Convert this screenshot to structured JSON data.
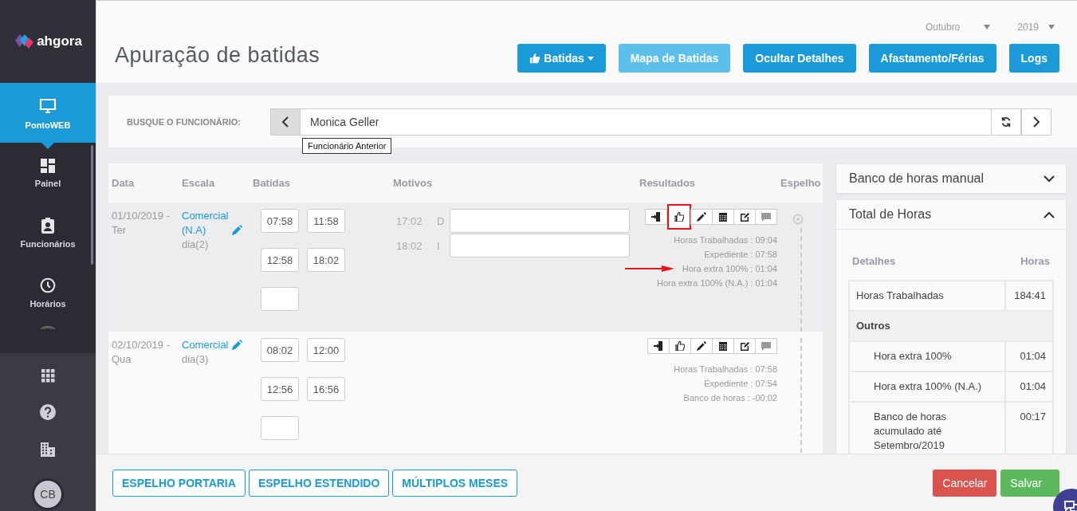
{
  "brand": {
    "name": "ahgora"
  },
  "nav": [
    {
      "label": "PontoWEB",
      "selected": true
    },
    {
      "label": "Painel",
      "selected": false
    },
    {
      "label": "Funcionários",
      "selected": false
    },
    {
      "label": "Horários",
      "selected": false
    }
  ],
  "tools": [
    {
      "kind": "apps"
    },
    {
      "kind": "help"
    },
    {
      "kind": "building"
    },
    {
      "kind": "avatar",
      "initials": "CB"
    }
  ],
  "header": {
    "title": "Apuração de batidas",
    "month": "Outubro",
    "year": "2019",
    "buttons": [
      {
        "label": "Batidas",
        "kind": "dropdown",
        "disabled": false
      },
      {
        "label": "Mapa de Batidas",
        "kind": "plain",
        "disabled": true
      },
      {
        "label": "Ocultar Detalhes",
        "kind": "plain",
        "disabled": false
      },
      {
        "label": "Afastamento/Férias",
        "kind": "plain",
        "disabled": false
      },
      {
        "label": "Logs",
        "kind": "plain",
        "disabled": false
      }
    ]
  },
  "search": {
    "label": "BUSQUE O FUNCIONÁRIO:",
    "value": "Monica Geller",
    "tooltip": "Funcionário Anterior"
  },
  "table": {
    "columns": [
      "Data",
      "Escala",
      "Batidas",
      "Motivos",
      "Resultados",
      "Espelho"
    ],
    "rows": [
      {
        "date": "01/10/2019 -",
        "weekday": "Ter",
        "scale": "Comercial (N.A)",
        "scale_day": "dia(2)",
        "shaded": true,
        "punches": [
          "07:58",
          "11:58",
          "12:58",
          "18:02"
        ],
        "add_field": true,
        "reasons": [
          {
            "time": "17:02",
            "code": "D"
          },
          {
            "time": "18:02",
            "code": "I"
          }
        ],
        "actions": [
          {
            "kind": "exit",
            "highlighted": false,
            "disabled": false
          },
          {
            "kind": "thumb",
            "highlighted": true,
            "disabled": false
          },
          {
            "kind": "pencil",
            "highlighted": false,
            "disabled": false
          },
          {
            "kind": "calendar",
            "highlighted": false,
            "disabled": false
          },
          {
            "kind": "edit",
            "highlighted": false,
            "disabled": false
          },
          {
            "kind": "comment",
            "highlighted": false,
            "disabled": true
          }
        ],
        "results": [
          {
            "text": "Horas Trabalhadas : 09:04",
            "pointed": false
          },
          {
            "text": "Expediente : 07:58",
            "pointed": false
          },
          {
            "text": "Hora extra 100% : 01:04",
            "pointed": true
          },
          {
            "text": "Hora extra 100% (N.A.) : 01:04",
            "pointed": false
          }
        ],
        "mirror_dot": true
      },
      {
        "date": "02/10/2019 -",
        "weekday": "Qua",
        "scale": "Comercial",
        "scale_day": "dia(3)",
        "shaded": false,
        "punches": [
          "08:02",
          "12:00",
          "12:56",
          "16:56"
        ],
        "add_field": true,
        "reasons": [],
        "actions": [
          {
            "kind": "exit",
            "highlighted": false,
            "disabled": false
          },
          {
            "kind": "thumb",
            "highlighted": false,
            "disabled": false
          },
          {
            "kind": "pencil",
            "highlighted": false,
            "disabled": false
          },
          {
            "kind": "calendar",
            "highlighted": false,
            "disabled": false
          },
          {
            "kind": "edit",
            "highlighted": false,
            "disabled": false
          },
          {
            "kind": "comment",
            "highlighted": false,
            "disabled": true
          }
        ],
        "results": [
          {
            "text": "Horas Trabalhadas : 07:58",
            "pointed": false
          },
          {
            "text": "Expediente : 07:54",
            "pointed": false
          },
          {
            "text": "Banco de horas : -00:02",
            "pointed": false
          }
        ],
        "mirror_dot": false
      }
    ]
  },
  "panels": [
    {
      "title": "Banco de horas manual",
      "expanded": false
    },
    {
      "title": "Total de Horas",
      "expanded": true,
      "columns": [
        "Detalhes",
        "Horas"
      ],
      "rows": [
        {
          "kind": "item",
          "label": "Horas Trabalhadas",
          "value": "184:41"
        },
        {
          "kind": "group",
          "label": "Outros"
        },
        {
          "kind": "sub",
          "label": "Hora extra 100%",
          "value": "01:04"
        },
        {
          "kind": "sub",
          "label": "Hora extra 100% (N.A.)",
          "value": "01:04"
        },
        {
          "kind": "sub",
          "label": "Banco de horas acumulado até Setembro/2019",
          "value": "00:17"
        }
      ]
    }
  ],
  "footer": {
    "links": [
      "ESPELHO PORTARIA",
      "ESPELHO ESTENDIDO",
      "MÚLTIPLOS MESES"
    ],
    "cancel": "Cancelar",
    "save": "Salvar"
  }
}
